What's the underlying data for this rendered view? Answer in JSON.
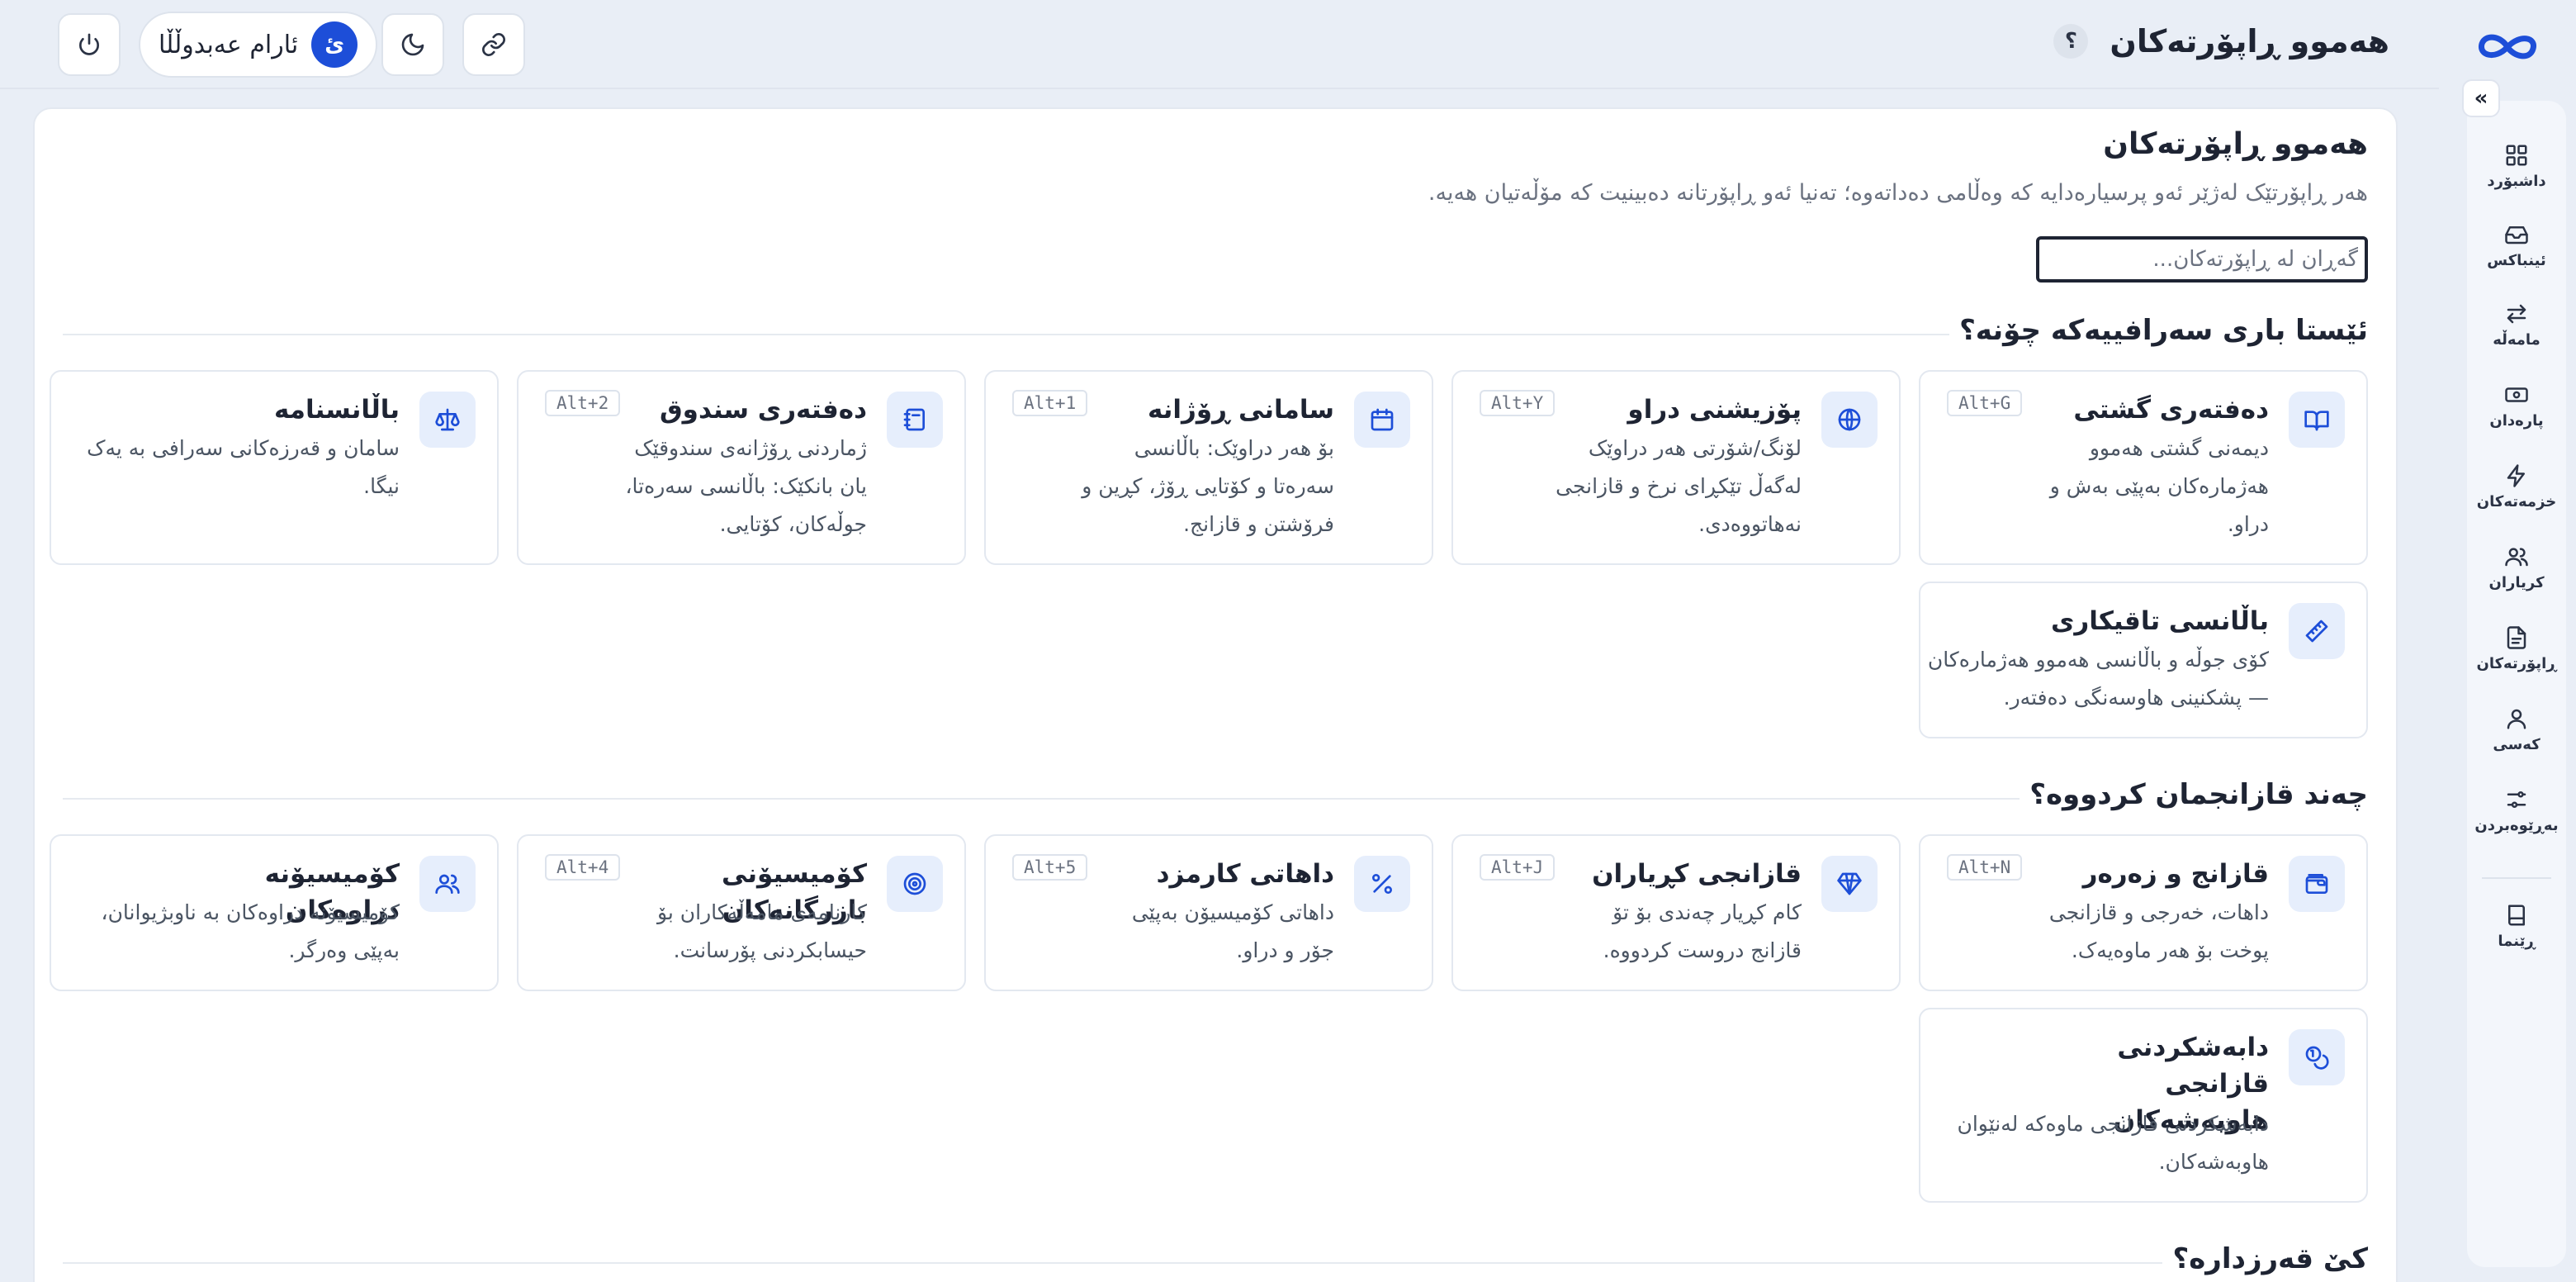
{
  "app": {
    "page_title": "هەموو ڕاپۆرتەکان",
    "help": "؟"
  },
  "user": {
    "name": "ئارام عەبدوڵڵا",
    "initial": "ئ"
  },
  "rail": {
    "items": [
      {
        "label": "داشبۆرد",
        "icon": "dashboard-icon"
      },
      {
        "label": "ئینباکس",
        "icon": "inbox-icon"
      },
      {
        "label": "مامەڵە",
        "icon": "transfer-icon"
      },
      {
        "label": "پارەدان",
        "icon": "cash-icon"
      },
      {
        "label": "خزمەتەکان",
        "icon": "bolt-icon"
      },
      {
        "label": "کریاران",
        "icon": "users-icon"
      },
      {
        "label": "ڕاپۆرتەکان",
        "icon": "report-icon"
      },
      {
        "label": "کەسی",
        "icon": "person-icon"
      },
      {
        "label": "بەڕێوەبردن",
        "icon": "sliders-icon"
      },
      {
        "label": "ڕێنما",
        "icon": "book-icon"
      }
    ]
  },
  "main": {
    "title": "هەموو ڕاپۆرتەکان",
    "subtitle": "هەر ڕاپۆرتێک لەژێر ئەو پرسیارەدایە کە وەڵامی دەداتەوە؛ تەنیا ئەو ڕاپۆرتانە دەبینیت کە مۆڵەتیان هەیە.",
    "search_placeholder": "گەڕان لە ڕاپۆرتەکان..."
  },
  "sections": [
    {
      "title": "ئێستا باری سەرافییەکە چۆنە؟",
      "cards": [
        {
          "title": "دەفتەری گشتی",
          "desc": [
            "دیمەنی گشتی هەموو",
            "هەژمارەکان بەپێی بەش و",
            "دراو."
          ],
          "kbd": "Alt+G",
          "icon": "book-open-icon"
        },
        {
          "title": "پۆزیشنی دراو",
          "desc": [
            "لۆنگ/شۆرتی هەر دراوێک",
            "لەگەڵ تێکڕای نرخ و قازانجی",
            "نەهاتووەدی."
          ],
          "kbd": "Alt+Y",
          "icon": "globe-icon"
        },
        {
          "title": "سامانی ڕۆژانە",
          "desc": [
            "بۆ هەر دراوێک: باڵانسی",
            "سەرەتا و کۆتایی ڕۆژ، کڕین و",
            "فرۆشتن و قازانج."
          ],
          "kbd": "Alt+1",
          "icon": "calendar-icon"
        },
        {
          "title": "دەفتەری سندوق",
          "desc": [
            "ژماردنی ڕۆژانەی سندوقێک",
            "یان بانکێک: باڵانسی سەرەتا،",
            "جوڵەکان، کۆتایی."
          ],
          "kbd": "Alt+2",
          "icon": "notebook-icon"
        },
        {
          "title": "باڵانسنامە",
          "desc": [
            "سامان و قەرزەکانی سەرافی بە یەک نیگا."
          ],
          "kbd": "",
          "icon": "scale-icon"
        },
        {
          "title": "باڵانسی تاقیکاری",
          "desc": [
            "کۆی جوڵە و باڵانسی هەموو هەژمارەکان",
            "— پشکنینی هاوسەنگی دەفتەر."
          ],
          "kbd": "",
          "icon": "ruler-icon"
        }
      ]
    },
    {
      "title": "چەند قازانجمان کردووە؟",
      "cards": [
        {
          "title": "قازانج و زەرەر",
          "desc": [
            "داهات، خەرجی و قازانجی",
            "پوخت بۆ هەر ماوەیەک."
          ],
          "kbd": "Alt+N",
          "icon": "wallet-icon"
        },
        {
          "title": "قازانجی کڕیاران",
          "desc": [
            "کام کڕیار چەندی بۆ تۆ",
            "قازانج دروست کردووە."
          ],
          "kbd": "Alt+J",
          "icon": "gem-icon"
        },
        {
          "title": "داهاتی کارمزد",
          "desc": [
            "داهاتی کۆمیسیۆن بەپێی",
            "جۆر و دراو."
          ],
          "kbd": "Alt+5",
          "icon": "percent-icon"
        },
        {
          "title": "کۆمیسیۆنی بازرگانەکان",
          "desc": [
            "کارنامەی مامەڵەکاران بۆ",
            "حیسابکردنی پۆرسانت."
          ],
          "kbd": "Alt+4",
          "icon": "target-icon"
        },
        {
          "title": "کۆمیسیۆنە دراوەکان",
          "desc": [
            "کۆمیسیۆنە دراوەکان بە ناوبژیوانان،",
            "بەپێی وەرگر."
          ],
          "kbd": "",
          "icon": "users-icon"
        },
        {
          "title": "دابەشکردنی قازانجی هاوبەشەکان",
          "desc": [
            "دابەشکردنی قازانجی ماوەکە لەنێوان",
            "هاوبەشەکان."
          ],
          "kbd": "",
          "icon": "coins-icon"
        }
      ]
    },
    {
      "title": "کێ قەرزدارە؟",
      "cards": []
    }
  ]
}
